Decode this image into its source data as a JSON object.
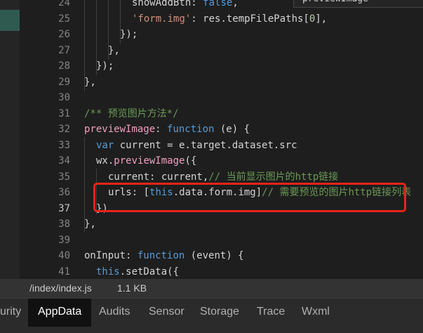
{
  "autocomplete": {
    "text": "previewImage"
  },
  "line_numbers": [
    "24",
    "25",
    "26",
    "27",
    "28",
    "29",
    "30",
    "31",
    "32",
    "33",
    "34",
    "35",
    "36",
    "37",
    "38",
    "39",
    "40",
    "41"
  ],
  "code": {
    "l24": {
      "a": "showAddBtn",
      "b": ": ",
      "c": "false",
      "d": ","
    },
    "l25": {
      "a": "'form.img'",
      "b": ": res.tempFilePaths[",
      "c": "0",
      "d": "],"
    },
    "l26": "});",
    "l27": "},",
    "l28": "});",
    "l29": "},",
    "l31": "/** 预览图片方法*/",
    "l32": {
      "a": "previewImage",
      "b": ": ",
      "c": "function",
      "d": " (e) {"
    },
    "l33": {
      "a": "var",
      "b": " current = e.target.dataset.src"
    },
    "l34": {
      "a": "wx.",
      "b": "previewImage",
      "c": "({"
    },
    "l35": {
      "a": "current: current,",
      "b": "// 当前显示图片的http链接"
    },
    "l36": {
      "a": "urls: [",
      "b": "this",
      "c": ".data.form.img]",
      "d": "// 需要预览的图片http链接列表"
    },
    "l37": "})",
    "l38": "},",
    "l40": {
      "a": "onInput",
      "b": ": ",
      "c": "function",
      "d": " (event) {"
    },
    "l41": {
      "a": "this",
      "b": ".setData({"
    }
  },
  "status": {
    "file": "/index/index.js",
    "size": "1.1 KB"
  },
  "tabs": [
    "urity",
    "AppData",
    "Audits",
    "Sensor",
    "Storage",
    "Trace",
    "Wxml"
  ],
  "colors": {
    "highlight_box": "#e8241a",
    "keyword": "#569cd6",
    "string": "#ce9178",
    "comment": "#6a9955"
  }
}
